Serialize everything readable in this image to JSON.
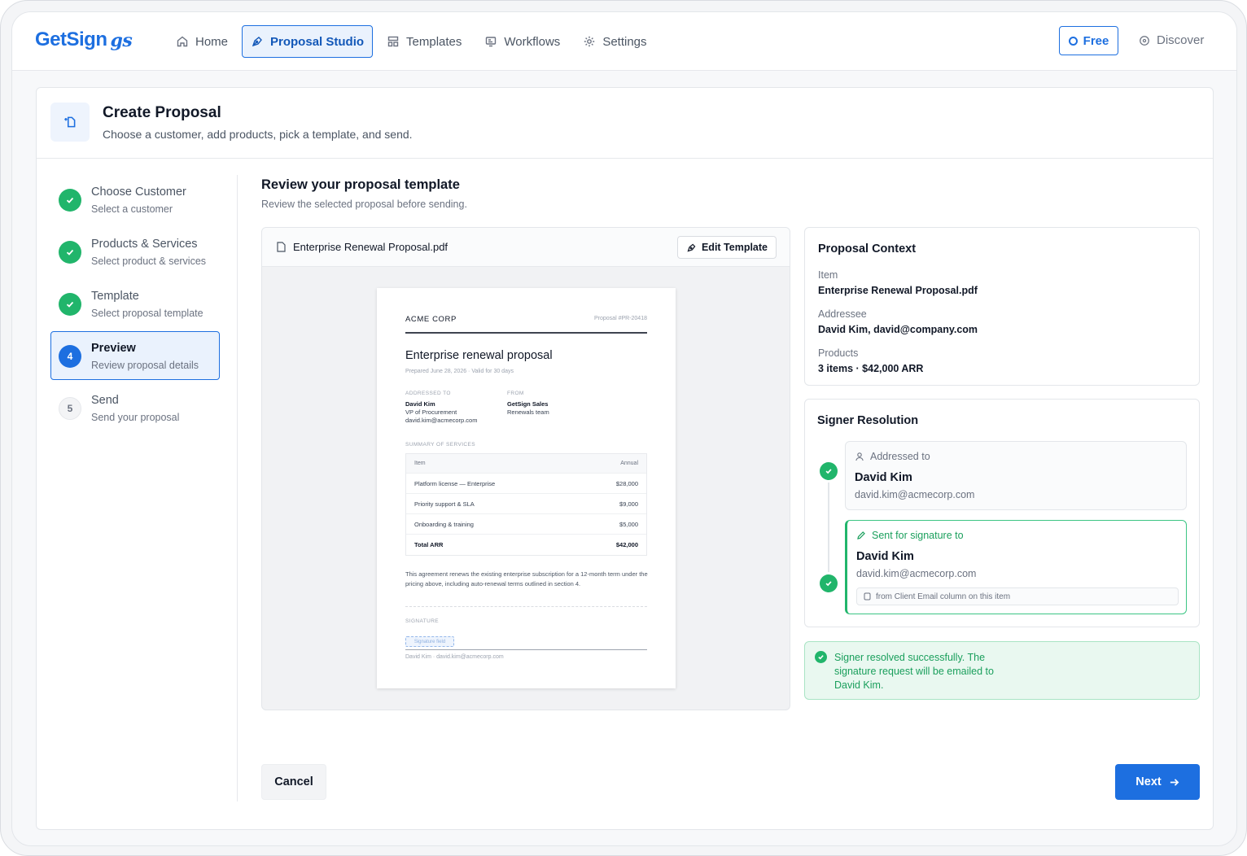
{
  "app": {
    "logo_text": "GetSign",
    "logo_mark": "gs"
  },
  "nav": {
    "items": [
      {
        "label": "Home",
        "icon": "home-icon",
        "active": false
      },
      {
        "label": "Proposal Studio",
        "icon": "pen-tool-icon",
        "active": true
      },
      {
        "label": "Templates",
        "icon": "layout-icon",
        "active": false
      },
      {
        "label": "Workflows",
        "icon": "workflow-icon",
        "active": false
      },
      {
        "label": "Settings",
        "icon": "gear-icon",
        "active": false
      }
    ],
    "free_label": "Free",
    "discover_label": "Discover"
  },
  "header": {
    "title": "Create Proposal",
    "subtitle": "Choose a customer, add products, pick a template, and send."
  },
  "steps": [
    {
      "title": "Choose Customer",
      "subtitle": "Select a customer",
      "state": "done",
      "number": "1"
    },
    {
      "title": "Products & Services",
      "subtitle": "Select product & services",
      "state": "done",
      "number": "2"
    },
    {
      "title": "Template",
      "subtitle": "Select proposal template",
      "state": "done",
      "number": "3"
    },
    {
      "title": "Preview",
      "subtitle": "Review proposal details",
      "state": "current",
      "number": "4"
    },
    {
      "title": "Send",
      "subtitle": "Send your proposal",
      "state": "pending",
      "number": "5"
    }
  ],
  "review": {
    "title": "Review your proposal template",
    "subtitle": "Review the selected proposal before sending."
  },
  "document": {
    "file_name": "Enterprise Renewal Proposal.pdf",
    "edit_label": "Edit Template",
    "company": "ACME CORP",
    "proposal_number": "Proposal #PR-20418",
    "title": "Enterprise renewal proposal",
    "prepared": "Prepared June 28, 2026 · Valid for 30 days",
    "addressed_label": "ADDRESSED TO",
    "addressed_name": "David Kim",
    "addressed_role": "VP of Procurement",
    "addressed_email": "david.kim@acmecorp.com",
    "from_label": "FROM",
    "from_name": "GetSign Sales",
    "from_team": "Renewals team",
    "summary_label": "SUMMARY OF SERVICES",
    "table_header": {
      "item": "Item",
      "annual": "Annual"
    },
    "table_rows": [
      {
        "item": "Platform license — Enterprise",
        "annual": "$28,000"
      },
      {
        "item": "Priority support & SLA",
        "annual": "$9,000"
      },
      {
        "item": "Onboarding & training",
        "annual": "$5,000"
      }
    ],
    "total": {
      "item": "Total ARR",
      "annual": "$42,000"
    },
    "paragraph": "This agreement renews the existing enterprise subscription for a 12-month term under the pricing above, including auto-renewal terms outlined in section 4.",
    "signature_label": "SIGNATURE",
    "signature_field": "Signature field",
    "signature_name": "David Kim · david.kim@acmecorp.com"
  },
  "context": {
    "title": "Proposal Context",
    "item_label": "Item",
    "item_value": "Enterprise Renewal Proposal.pdf",
    "addressee_label": "Addressee",
    "addressee_value": "David Kim, david@company.com",
    "products_label": "Products",
    "products_value": "3 items · $42,000 ARR"
  },
  "signer": {
    "title": "Signer Resolution",
    "addressed_label": "Addressed to",
    "addressed_name": "David Kim",
    "addressed_email": "david.kim@acmecorp.com",
    "sent_label": "Sent for signature to",
    "sent_name": "David Kim",
    "sent_email": "david.kim@acmecorp.com",
    "source_note": "from Client Email column on this item"
  },
  "success_message": "Signer resolved successfully. The signature request will be emailed to David Kim.",
  "actions": {
    "cancel_label": "Cancel",
    "next_label": "Next"
  },
  "colors": {
    "brand": "#1d6fe0",
    "success": "#21b56b"
  }
}
